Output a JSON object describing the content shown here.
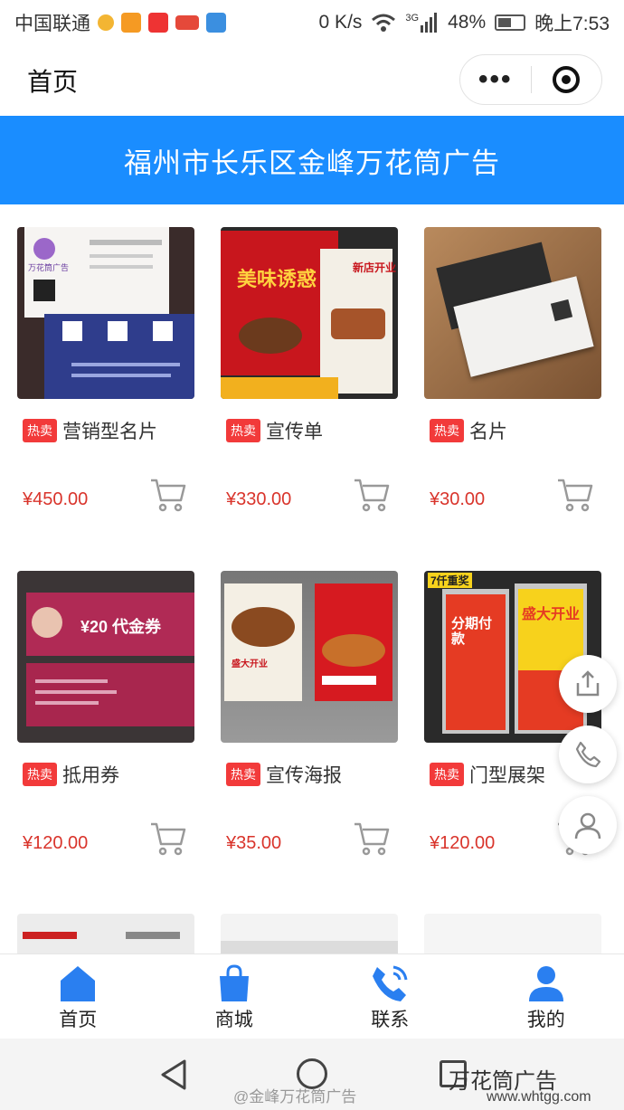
{
  "status_bar": {
    "carrier": "中国联通",
    "speed": "0 K/s",
    "network": "3G",
    "battery": "48%",
    "time": "晚上7:53"
  },
  "title_bar": {
    "title": "首页",
    "more_icon": "more-dots-icon",
    "close_icon": "target-icon"
  },
  "banner": {
    "text": "福州市长乐区金峰万花筒广告"
  },
  "colors": {
    "accent": "#1a8dff",
    "hot_badge": "#f23a3a",
    "price": "#d9342b"
  },
  "products": [
    {
      "badge": "热卖",
      "name": "营销型名片",
      "price": "¥450.00"
    },
    {
      "badge": "热卖",
      "name": "宣传单",
      "price": "¥330.00"
    },
    {
      "badge": "热卖",
      "name": "名片",
      "price": "¥30.00"
    },
    {
      "badge": "热卖",
      "name": "抵用券",
      "price": "¥120.00"
    },
    {
      "badge": "热卖",
      "name": "宣传海报",
      "price": "¥35.00"
    },
    {
      "badge": "热卖",
      "name": "门型展架",
      "price": "¥120.00"
    }
  ],
  "thumb_text": {
    "p1_title": "万花筒广告",
    "p2_title": "美味诱惑",
    "p2_sub": "新店开业",
    "p4_amount": "¥20 代金券",
    "p5_tag": "盛大开业",
    "p6_a": "分期付款",
    "p6_b": "盛大开业",
    "p6_top": "7仟重奖"
  },
  "floating": [
    "share-icon",
    "phone-icon",
    "user-icon"
  ],
  "tabs": [
    {
      "label": "首页",
      "icon": "home-icon"
    },
    {
      "label": "商城",
      "icon": "bag-icon"
    },
    {
      "label": "联系",
      "icon": "phone-icon"
    },
    {
      "label": "我的",
      "icon": "user-icon"
    }
  ],
  "watermark": {
    "weibo": "@金峰万花筒广告",
    "brand": "万花筒广告",
    "url": "www.whtgg.com"
  }
}
